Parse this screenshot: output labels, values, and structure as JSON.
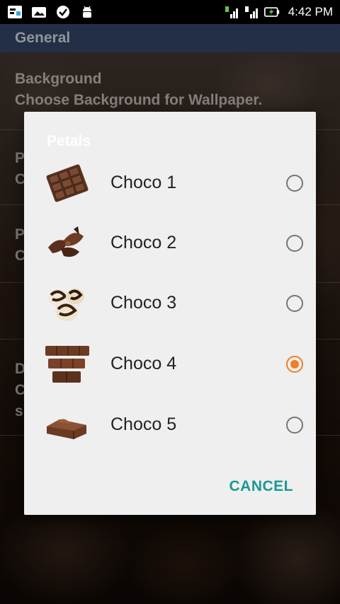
{
  "status_bar": {
    "time": "4:42 PM",
    "left_icons": [
      "screenshot-app-icon",
      "image-icon",
      "check-circle-icon",
      "android-icon"
    ],
    "right_icons": [
      "signal-1-icon",
      "signal-2-icon",
      "battery-charging-icon"
    ]
  },
  "settings": {
    "header": "General",
    "rows": [
      {
        "title": "Background",
        "subtitle": "Choose Background for Wallpaper."
      },
      {
        "title": "P",
        "subtitle": "C"
      },
      {
        "title": "P",
        "subtitle": "C"
      },
      {
        "title": "D",
        "subtitle": "C",
        "extra": "s"
      }
    ]
  },
  "dialog": {
    "title": "Petals",
    "options": [
      {
        "label": "Choco 1",
        "thumb": "chocolate-bar-icon",
        "selected": false
      },
      {
        "label": "Choco 2",
        "thumb": "chocolate-curls-icon",
        "selected": false
      },
      {
        "label": "Choco 3",
        "thumb": "chocolate-swirl-cookies-icon",
        "selected": false
      },
      {
        "label": "Choco 4",
        "thumb": "chocolate-pieces-stack-icon",
        "selected": true
      },
      {
        "label": "Choco 5",
        "thumb": "chocolate-piece-icon",
        "selected": false
      }
    ],
    "cancel_label": "CANCEL"
  },
  "colors": {
    "accent": "#ef7e24",
    "cancel_text": "#1a9896",
    "dialog_bg": "#efefef"
  }
}
